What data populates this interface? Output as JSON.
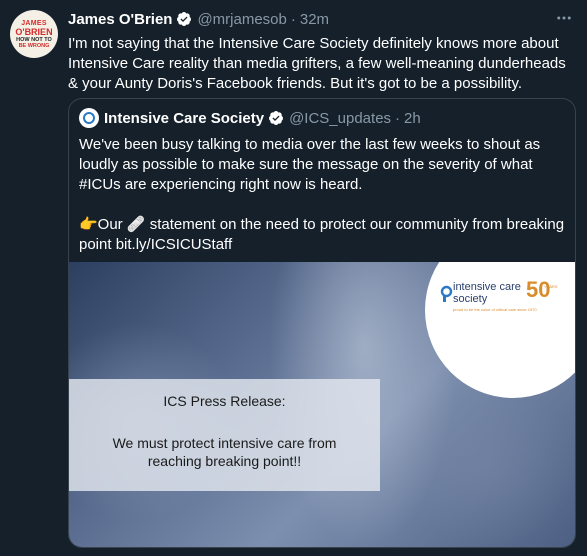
{
  "tweet": {
    "avatar": {
      "line1": "JAMES",
      "line2": "O'BRIEN",
      "line3": "HOW NOT TO",
      "line4": "BE WRONG"
    },
    "name": "James O'Brien",
    "handle": "@mrjamesob",
    "separator": "·",
    "time": "32m",
    "more_icon": "more-horizontal-icon",
    "text": "I'm not saying that the Intensive Care Society definitely knows more about Intensive Care reality than media grifters, a few well-meaning dunderheads & your Aunty Doris's Facebook friends. But it's got to be a possibility."
  },
  "quote": {
    "name": "Intensive Care Society",
    "handle": "@ICS_updates",
    "separator": "·",
    "time": "2h",
    "paragraph1": "We've been busy talking to media over the last few weeks to shout as loudly as possible to make sure the message on the severity of what #ICUs are experiencing right now is heard.",
    "paragraph2": "👉Our 🩹 statement on the need to protect our community from breaking point bit.ly/ICSICUStaff",
    "media": {
      "logo_line1": "intensive care",
      "logo_line2": "society",
      "logo_number": "50",
      "logo_years": "YEARS",
      "logo_strap": "proud to be the voice of critical care since 1970",
      "press_title": "ICS Press Release:",
      "press_line1": "We must protect intensive care from",
      "press_line2": "reaching breaking point!!"
    }
  },
  "colors": {
    "background": "#15202b",
    "secondary_text": "#8899a6",
    "verified": "#ffffff",
    "border": "#38444d"
  }
}
